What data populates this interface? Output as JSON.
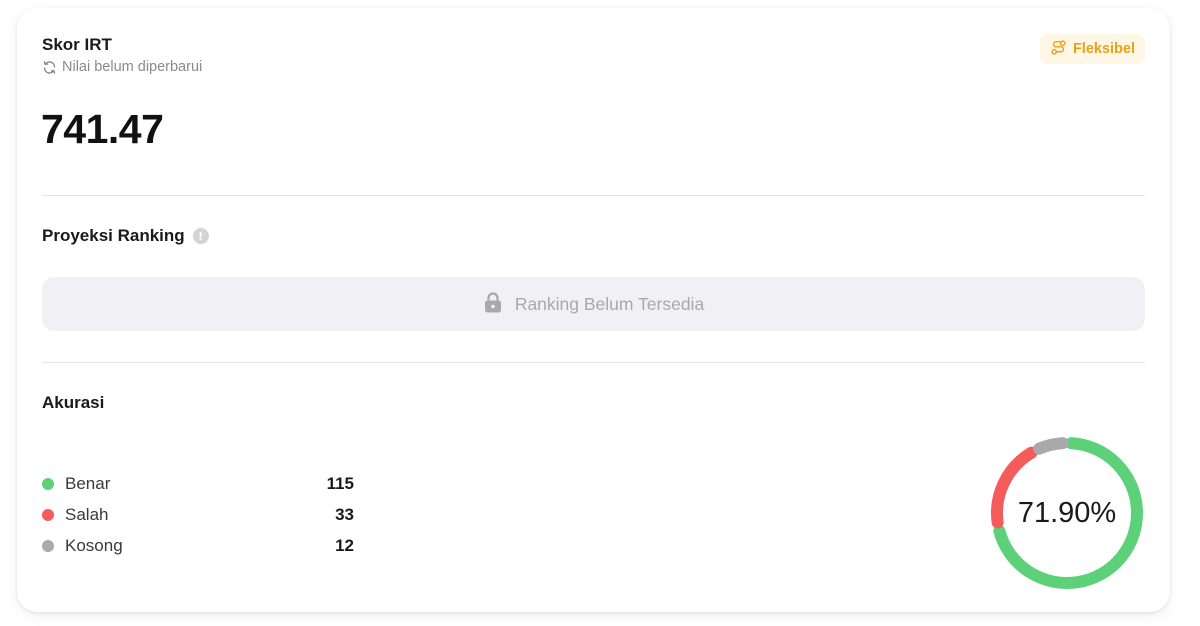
{
  "card": {
    "title": "Skor IRT",
    "subtitle": "Nilai belum diperbarui",
    "badge_label": "Fleksibel",
    "score": "741.47"
  },
  "ranking": {
    "title": "Proyeksi Ranking",
    "info_glyph": "!",
    "status": "Ranking Belum Tersedia"
  },
  "accuracy": {
    "title": "Akurasi",
    "percent_label": "71.90%",
    "items": [
      {
        "label": "Benar",
        "value": "115",
        "color": "#5cd17a"
      },
      {
        "label": "Salah",
        "value": "33",
        "color": "#f45b5b"
      },
      {
        "label": "Kosong",
        "value": "12",
        "color": "#a9a9ad"
      }
    ]
  },
  "colors": {
    "accent_badge": "#e8a21a",
    "benar": "#5cd17a",
    "salah": "#f45b5b",
    "kosong": "#a9a9ad"
  },
  "icons": [
    "refresh-icon",
    "route-icon",
    "info-icon",
    "lock-icon"
  ],
  "chart_data": {
    "type": "pie",
    "categories": [
      "Benar",
      "Salah",
      "Kosong"
    ],
    "values": [
      115,
      33,
      12
    ],
    "title": "",
    "center_label": "71.90%"
  }
}
